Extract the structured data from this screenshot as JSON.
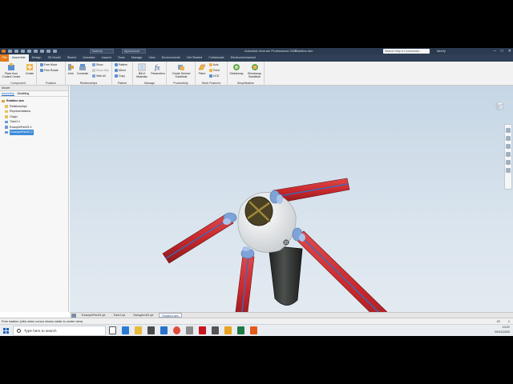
{
  "titlebar": {
    "material_combo": "Material",
    "appearance_combo": "Appearance",
    "app_title": "Autodesk Inventor Professional 2020",
    "file_name": "Rotation.iam",
    "search_placeholder": "Search Help & Commands...",
    "user": "fabrify"
  },
  "menu_tabs": {
    "file": "File",
    "tabs": [
      "Assemble",
      "Design",
      "3D Model",
      "Sketch",
      "Annotate",
      "Inspect",
      "Tools",
      "Manage",
      "View",
      "Environments",
      "Get Started",
      "Collaborate",
      "Electromechanical"
    ]
  },
  "ribbon": {
    "component": {
      "label": "Component",
      "place": "Place from Content Center",
      "create": "Create"
    },
    "position": {
      "label": "Position",
      "free_move": "Free Move",
      "free_rotate": "Free Rotate"
    },
    "relationships": {
      "label": "Relationships",
      "joint": "Joint",
      "constrain": "Constrain",
      "show": "Show",
      "show_sick": "Show Sick",
      "hide_all": "Hide All"
    },
    "pattern": {
      "label": "Pattern",
      "pattern": "Pattern",
      "mirror": "Mirror",
      "copy": "Copy"
    },
    "manage": {
      "label": "Manage",
      "bom": "Bill of Materials",
      "parameters": "Parameters"
    },
    "productivity": {
      "label": "Productivity",
      "derived": "Create Derived Substitute"
    },
    "work_features": {
      "label": "Work Features",
      "plane": "Plane",
      "axis": "Axis",
      "point": "Point",
      "ucs": "UCS"
    },
    "simplification": {
      "label": "Simplification",
      "shrinkwrap": "Shrinkwrap",
      "shrinkwrap_sub": "Shrinkwrap Substitute"
    }
  },
  "browser": {
    "title": "Model",
    "tabs": [
      "Assembly",
      "Modeling"
    ],
    "items": [
      "Rotation.iam",
      "Relationships",
      "Representations",
      "Origin",
      "Tube1:1",
      "ExamplePart01:1",
      "ExamplePart01:2"
    ]
  },
  "doc_tabs": [
    "ExamplePart01.ipt",
    "Tube1.ipt",
    "SwingArm01.ipt",
    "Rotation.iam"
  ],
  "status": {
    "message": "Free rotation (click when cursor shows rotate to center view)",
    "num1": "22",
    "num2": "1"
  },
  "taskbar": {
    "search_placeholder": "Type here to search",
    "time": "13:21",
    "date": "09/11/2020"
  },
  "colors": {
    "arm_red": "#c8282c",
    "hub_white": "#e9ecee",
    "tube_dark": "#2e3130",
    "cap_blue": "#7fa3d8",
    "accent_orange": "#e07a1b"
  }
}
